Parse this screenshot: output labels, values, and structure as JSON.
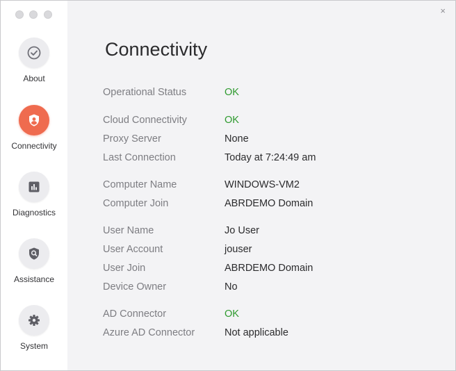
{
  "window": {
    "close_label": "×"
  },
  "sidebar": {
    "items": [
      {
        "label": "About",
        "icon": "check-circle-icon",
        "active": false
      },
      {
        "label": "Connectivity",
        "icon": "user-shield-icon",
        "active": true
      },
      {
        "label": "Diagnostics",
        "icon": "bar-chart-icon",
        "active": false
      },
      {
        "label": "Assistance",
        "icon": "search-shield-icon",
        "active": false
      },
      {
        "label": "System",
        "icon": "gear-icon",
        "active": false
      }
    ]
  },
  "main": {
    "title": "Connectivity",
    "rows": [
      {
        "label": "Operational Status",
        "value": "OK"
      },
      {
        "label": "Cloud Connectivity",
        "value": "OK"
      },
      {
        "label": "Proxy Server",
        "value": "None"
      },
      {
        "label": "Last Connection",
        "value": "Today at 7:24:49 am"
      },
      {
        "label": "Computer Name",
        "value": "WINDOWS-VM2"
      },
      {
        "label": "Computer Join",
        "value": "ABRDEMO Domain"
      },
      {
        "label": "User Name",
        "value": "Jo User"
      },
      {
        "label": "User Account",
        "value": "jouser"
      },
      {
        "label": "User Join",
        "value": "ABRDEMO Domain"
      },
      {
        "label": "Device Owner",
        "value": "No"
      },
      {
        "label": "AD Connector",
        "value": "OK"
      },
      {
        "label": "Azure AD Connector",
        "value": "Not applicable"
      }
    ]
  },
  "colors": {
    "accent": "#ef6b4f",
    "status_ok": "#2e9a2e",
    "sidebar_bg": "#ffffff",
    "content_bg": "#f3f3f5"
  }
}
